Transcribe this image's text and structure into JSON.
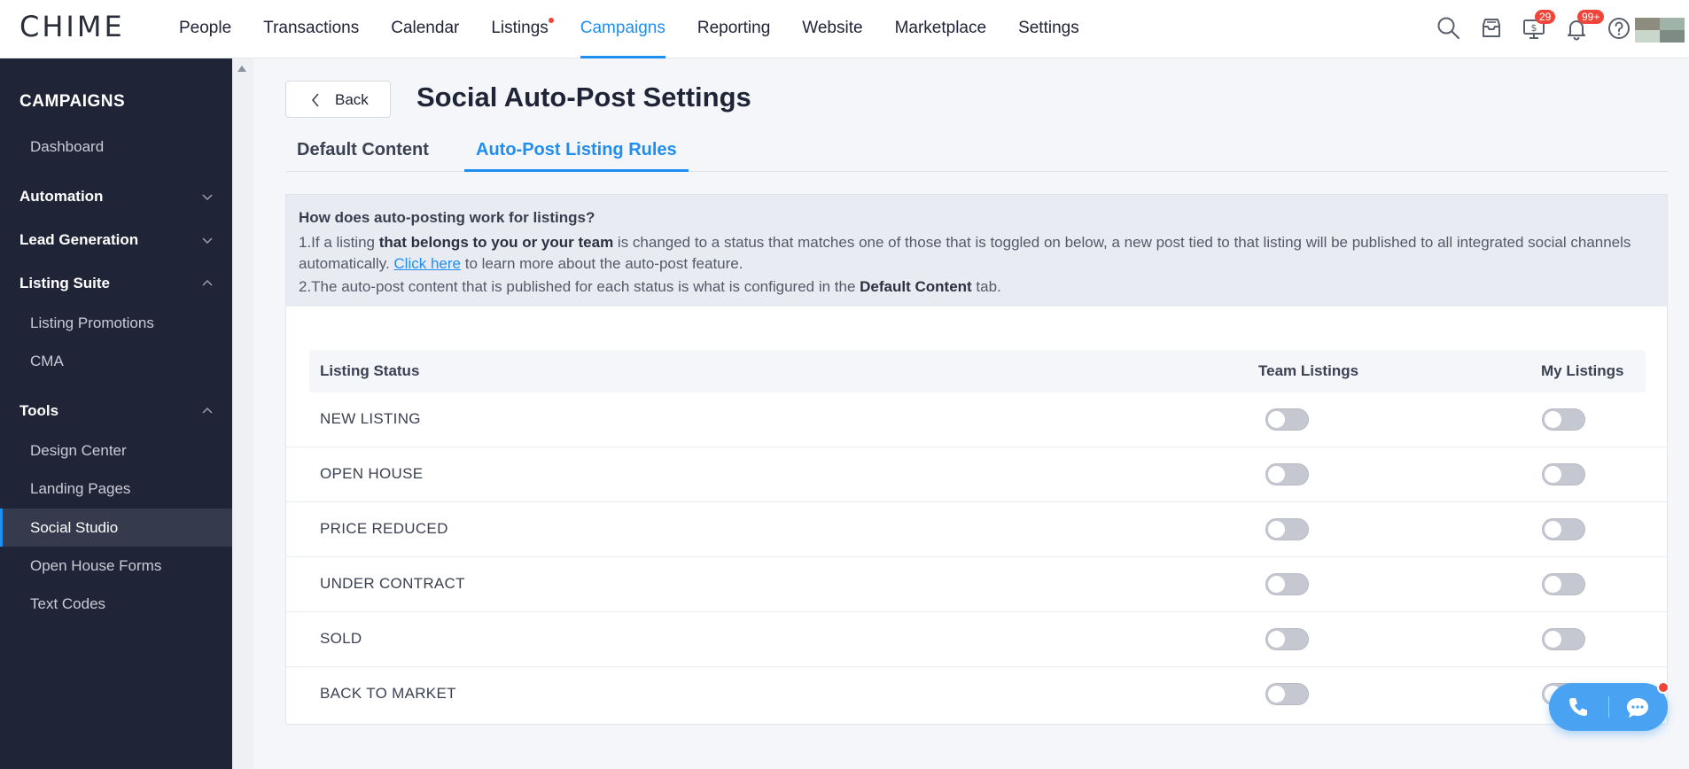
{
  "brand": {
    "logo": "CHIME",
    "accent": "#1f8ef1"
  },
  "nav": {
    "items": [
      {
        "label": "People"
      },
      {
        "label": "Transactions"
      },
      {
        "label": "Calendar"
      },
      {
        "label": "Listings"
      },
      {
        "label": "Campaigns"
      },
      {
        "label": "Reporting"
      },
      {
        "label": "Website"
      },
      {
        "label": "Marketplace"
      },
      {
        "label": "Settings"
      }
    ],
    "active": "Campaigns"
  },
  "toolbar": {
    "icons": [
      "search-icon",
      "inbox-icon",
      "dollar-monitor-icon",
      "bell-icon",
      "help-icon"
    ],
    "dollar_badge": "29",
    "bell_badge": "99+"
  },
  "sidebar": {
    "title": "CAMPAIGNS",
    "dashboard": "Dashboard",
    "automation": "Automation",
    "lead_generation": "Lead Generation",
    "listing_suite": "Listing Suite",
    "listing_promotions": "Listing Promotions",
    "cma": "CMA",
    "tools": "Tools",
    "design_center": "Design Center",
    "landing_pages": "Landing Pages",
    "social_studio": "Social Studio",
    "open_house_forms": "Open House Forms",
    "text_codes": "Text Codes",
    "active": "Social Studio"
  },
  "header": {
    "back_label": "Back",
    "title": "Social Auto-Post Settings"
  },
  "tabs": [
    {
      "label": "Default Content"
    },
    {
      "label": "Auto-Post Listing Rules"
    }
  ],
  "info": {
    "question": "How does auto-posting work for listings?",
    "line1_a": "1.If a listing ",
    "line1_bold": "that belongs to you or your team",
    "line1_b": " is changed to a status that matches one of those that is toggled on below, a new post tied to that listing will be published to all integrated social channels automatically. ",
    "link": "Click here",
    "line1_c": " to learn more about the auto-post feature.",
    "line2_a": "2.The auto-post content that is published for each status is what is configured in the ",
    "line2_bold": "Default Content",
    "line2_b": " tab."
  },
  "table": {
    "columns": [
      "Listing Status",
      "Team Listings",
      "My Listings"
    ],
    "rows": [
      {
        "status": "NEW LISTING",
        "team": false,
        "mine": false
      },
      {
        "status": "OPEN HOUSE",
        "team": false,
        "mine": false
      },
      {
        "status": "PRICE REDUCED",
        "team": false,
        "mine": false
      },
      {
        "status": "UNDER CONTRACT",
        "team": false,
        "mine": false
      },
      {
        "status": "SOLD",
        "team": false,
        "mine": false
      },
      {
        "status": "BACK TO MARKET",
        "team": false,
        "mine": false
      }
    ]
  }
}
